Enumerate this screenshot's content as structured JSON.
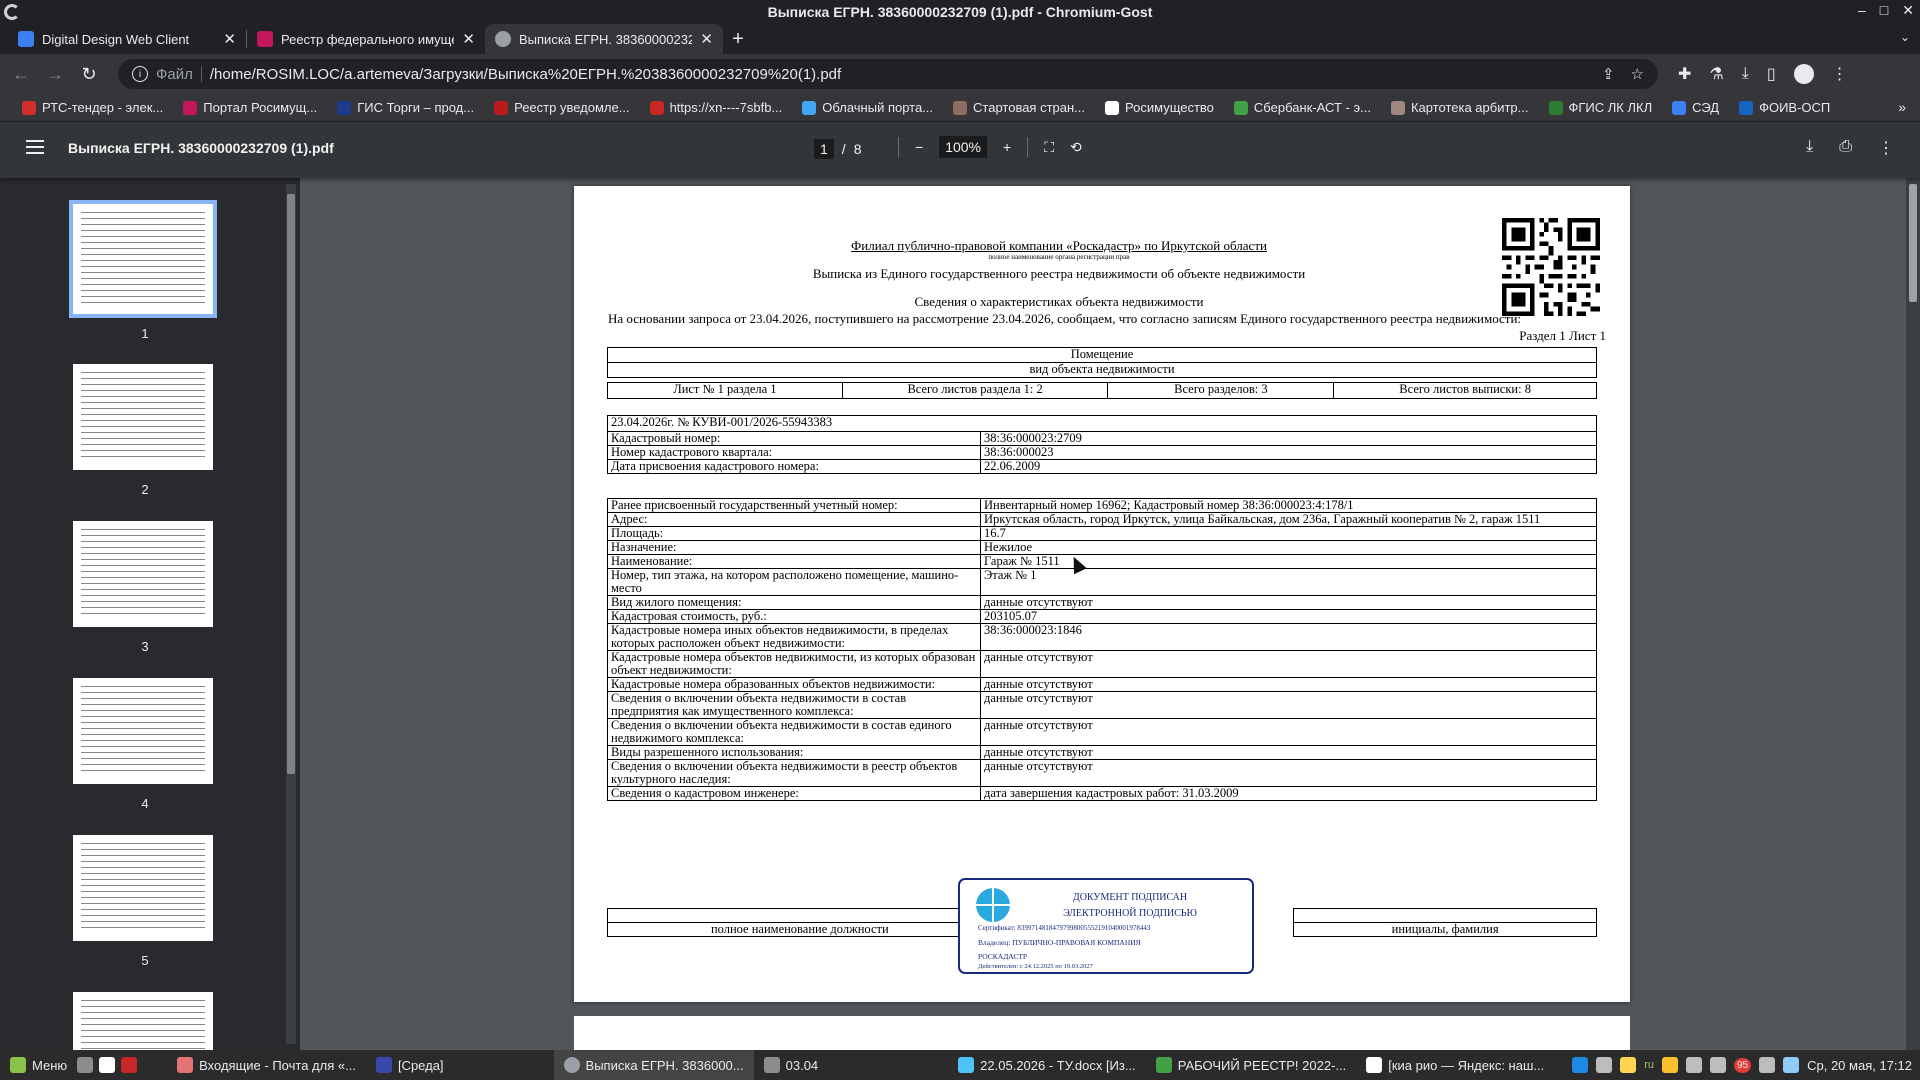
{
  "window": {
    "title": "Выписка ЕГРН. 38360000232709 (1).pdf - Chromium-Gost"
  },
  "tabs": [
    {
      "label": "Digital Design Web Client",
      "color": "#3d7ef5"
    },
    {
      "label": "Реестр федерального имуще",
      "color": "#c2185b"
    },
    {
      "label": "Выписка ЕГРН. 38360000232709",
      "color": "#9aa0a6",
      "active": true
    }
  ],
  "toolbar": {
    "scheme": "Файл",
    "url": "/home/ROSIM.LOC/a.artemeva/Загрузки/Выписка%20ЕГРН.%2038360000232709%20(1).pdf"
  },
  "bookmarks": [
    {
      "label": "РТС-тендер - элек...",
      "color": "#d32f2f"
    },
    {
      "label": "Портал Росимущ...",
      "color": "#c2185b"
    },
    {
      "label": "ГИС Торги – прод...",
      "color": "#1e3a8a"
    },
    {
      "label": "Реестр уведомле...",
      "color": "#b71c1c"
    },
    {
      "label": "https://xn----7sbfb...",
      "color": "#c62828"
    },
    {
      "label": "Облачный порта...",
      "color": "#42a5f5"
    },
    {
      "label": "Стартовая стран...",
      "color": "#8d6e63"
    },
    {
      "label": "Росимущество",
      "color": "#ffffff"
    },
    {
      "label": "Сбербанк-АСТ - э...",
      "color": "#43a047"
    },
    {
      "label": "Картотека арбитр...",
      "color": "#a1887f"
    },
    {
      "label": "ФГИС ЛК ЛКЛ",
      "color": "#2e7d32"
    },
    {
      "label": "СЭД",
      "color": "#3d7ef5"
    },
    {
      "label": "ФОИВ-ОСП",
      "color": "#1565c0"
    }
  ],
  "pdf": {
    "doc_name": "Выписка ЕГРН. 38360000232709 (1).pdf",
    "current_page": "1",
    "page_sep": "/",
    "total_pages": "8",
    "zoom": "100%"
  },
  "thumbnails": [
    "1",
    "2",
    "3",
    "4",
    "5"
  ],
  "document": {
    "org": "Филиал публично-правовой компании «Роскадастр» по Иркутской области",
    "org_sub": "полное наименование органа регистрации прав",
    "heading": "Выписка из Единого государственного реестра недвижимости об объекте недвижимости",
    "subtitle": "Сведения о характеристиках объекта недвижимости",
    "basis": "На  основании запроса от 23.04.2026, поступившего на рассмотрение 23.04.2026, сообщаем, что согласно записям Единого государственного реестра недвижимости:",
    "section_ref": "Раздел 1 Лист 1",
    "object_type": "Помещение",
    "object_type_label": "вид объекта недвижимости",
    "sheet_info": [
      "Лист № 1 раздела 1",
      "Всего листов раздела 1: 2",
      "Всего разделов: 3",
      "Всего листов выписки: 8"
    ],
    "request_ref": "23.04.2026г. № КУВИ-001/2026-55943383",
    "table1": [
      {
        "k": "Кадастровый номер:",
        "v": "38:36:000023:2709"
      },
      {
        "k": "Номер кадастрового квартала:",
        "v": "38:36:000023"
      },
      {
        "k": "Дата присвоения кадастрового номера:",
        "v": "22.06.2009"
      }
    ],
    "table2": [
      {
        "k": "Ранее присвоенный государственный учетный номер:",
        "v": "Инвентарный номер 16962; Кадастровый номер 38:36:000023:4:178/1"
      },
      {
        "k": "Адрес:",
        "v": "Иркутская область, город Иркутск, улица Байкальская, дом 236а, Гаражный кооператив № 2, гараж 1511"
      },
      {
        "k": "Площадь:",
        "v": "16.7"
      },
      {
        "k": "Назначение:",
        "v": "Нежилое"
      },
      {
        "k": "Наименование:",
        "v": "Гараж № 1511"
      },
      {
        "k": "Номер, тип этажа, на котором расположено помещение, машино-место",
        "v": "Этаж № 1"
      },
      {
        "k": "Вид жилого помещения:",
        "v": "данные отсутствуют"
      },
      {
        "k": "Кадастровая стоимость, руб.:",
        "v": "203105.07"
      },
      {
        "k": "Кадастровые номера иных объектов недвижимости, в пределах которых расположен объект недвижимости:",
        "v": "38:36:000023:1846"
      },
      {
        "k": "Кадастровые номера объектов недвижимости, из которых образован объект недвижимости:",
        "v": "данные отсутствуют"
      },
      {
        "k": "Кадастровые номера образованных объектов недвижимости:",
        "v": "данные отсутствуют"
      },
      {
        "k": "Сведения о включении объекта недвижимости в состав предприятия как имущественного комплекса:",
        "v": "данные отсутствуют"
      },
      {
        "k": "Сведения о включении объекта недвижимости в состав единого недвижимого комплекса:",
        "v": "данные отсутствуют"
      },
      {
        "k": "Виды разрешенного использования:",
        "v": "данные отсутствуют"
      },
      {
        "k": "Сведения о включении объекта недвижимости в реестр объектов культурного наследия:",
        "v": "данные отсутствуют"
      },
      {
        "k": "Сведения о кадастровом инженере:",
        "v": "дата завершения кадастровых работ: 31.03.2009"
      }
    ],
    "sign_position": "полное наименование должности",
    "sign_name": "инициалы, фамилия",
    "stamp": {
      "h1": "ДОКУМЕНТ ПОДПИСАН",
      "h2": "ЭЛЕКТРОННОЙ ПОДПИСЬЮ",
      "cert": "Сертификат: 8399714818479799800555219104000197844З",
      "owner": "Владелец: ПУБЛИЧНО-ПРАВОВАЯ КОМПАНИЯ",
      "owner2": "РОСКАДАСТР",
      "valid": "Действителен: с 24.12.2025 по 19.03.2027"
    }
  },
  "taskbar": {
    "menu": "Меню",
    "items": [
      {
        "label": "Входящие - Почта для «...",
        "color": "#e57373"
      },
      {
        "label": "[Среда]",
        "color": "#3949ab"
      },
      {
        "label": "Выписка ЕГРН. 3836000...",
        "color": "#9aa0a6",
        "active": true
      },
      {
        "label": "03.04",
        "color": "#8d8d8d"
      },
      {
        "label": "22.05.2026 - ТУ.docx [Из...",
        "color": "#4fc3f7"
      },
      {
        "label": "РАБОЧИЙ РЕЕСТР! 2022-...",
        "color": "#43a047"
      },
      {
        "label": "[киа рио — Яндекс: наш...",
        "color": "#ffffff"
      }
    ],
    "lang": "ru",
    "badge": "95",
    "clock": "Ср, 20 мая, 17:12"
  }
}
